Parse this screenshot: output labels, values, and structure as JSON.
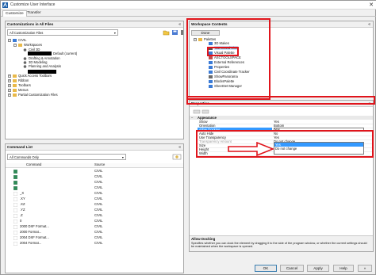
{
  "window": {
    "title": "Customize User Interface",
    "close_glyph": "✕"
  },
  "tabs": [
    {
      "label": "Customize"
    },
    {
      "label": "Transfer"
    }
  ],
  "customizations": {
    "header": "Customizations in All Files",
    "pin": "«",
    "filter_value": "All Customization Files",
    "tree": {
      "root": "CIVIL",
      "workspaces": "Workspaces",
      "items": [
        "Civil 3D",
        "Default (current)",
        "Drafting & Annotation",
        "3D Modeling",
        "Planning and Analysis"
      ],
      "rest": [
        "Quick Access Toolbars",
        "Ribbon",
        "Toolbars",
        "Menus",
        "Partial Customization Files"
      ]
    }
  },
  "commands": {
    "header": "Command List",
    "pin": "«",
    "filter_value": "All Commands Only",
    "col_command": "Command",
    "col_source": "Source",
    "rows": [
      {
        "name": "",
        "source": "CIVIL"
      },
      {
        "name": "",
        "source": "CIVIL"
      },
      {
        "name": "",
        "source": "CIVIL"
      },
      {
        "name": "",
        "source": "CIVIL"
      },
      {
        "name": "_X",
        "source": "CIVIL"
      },
      {
        "name": ".XY",
        "source": "CIVIL"
      },
      {
        "name": ".XZ",
        "source": "CIVIL"
      },
      {
        "name": ".YZ",
        "source": "CIVIL"
      },
      {
        "name": ".Z",
        "source": "CIVIL"
      },
      {
        "name": "0",
        "source": "CIVIL"
      },
      {
        "name": "2000 DXF Format...",
        "source": "CIVIL"
      },
      {
        "name": "2000 Format...",
        "source": "CIVIL"
      },
      {
        "name": "2004 DXF Format...",
        "source": "CIVIL"
      },
      {
        "name": "2004 Format...",
        "source": "CIVIL"
      }
    ]
  },
  "workspace": {
    "header": "Workspace Contents",
    "done_label": "Done",
    "palettes": "Palettes",
    "items": [
      "3D Makes",
      "Command Line",
      "Visual Palette",
      "ASCTOOLSPACE",
      "External References",
      "Properties",
      "Civil Coordinate Tracker",
      "ShowPanorama",
      "BlocksPalette",
      "SheetSet Manager"
    ]
  },
  "properties": {
    "header": "Properties",
    "section": "Appearance",
    "rows": [
      {
        "key": "Show",
        "value": "Yes"
      },
      {
        "key": "Orientation",
        "value": "Bottom"
      },
      {
        "key": "Allow Docking",
        "value": "Yes"
      },
      {
        "key": "Auto Hide",
        "value": "No"
      },
      {
        "key": "Use Transparency",
        "value": "Yes"
      },
      {
        "key": "Transparency Amount",
        "value": "Do not change"
      },
      {
        "key": "Size",
        "value": ""
      },
      {
        "key": "Height",
        "value": ""
      },
      {
        "key": "Width",
        "value": "918"
      }
    ],
    "dropdown_options": [
      "Yes",
      "No",
      "Yes",
      "Do not change"
    ],
    "description_title": "Allow Docking",
    "description_text": "Specifies whether you can dock the element by dragging it to the side of the program window, or whether the current settings should be maintained when the workspace is opened."
  },
  "buttons": {
    "ok": "OK",
    "cancel": "Cancel",
    "apply": "Apply",
    "help": "Help",
    "arrow": "»"
  },
  "colors": {
    "annotation": "#e0141b",
    "selection": "#3399ff",
    "header_bg": "#f0f0f0"
  }
}
